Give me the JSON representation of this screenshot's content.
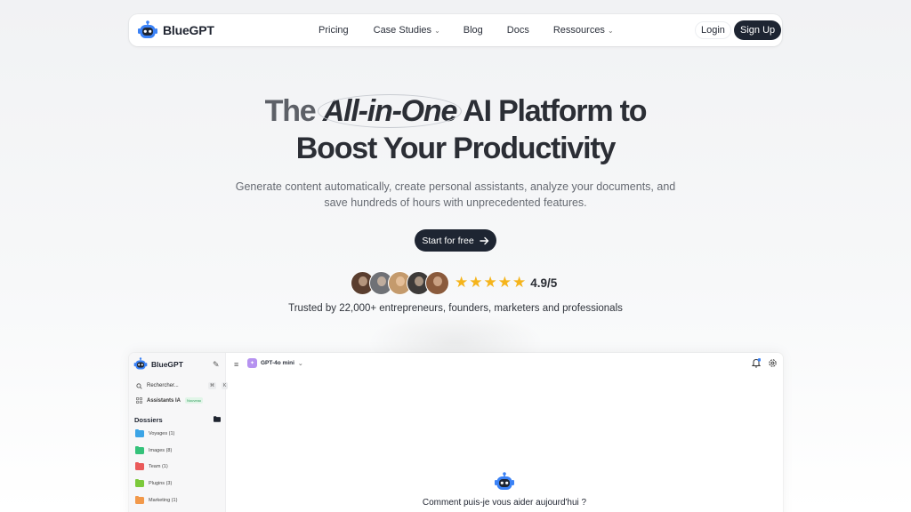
{
  "brand": {
    "name": "BlueGPT"
  },
  "nav": {
    "items": [
      {
        "label": "Pricing",
        "dropdown": false
      },
      {
        "label": "Case Studies",
        "dropdown": true
      },
      {
        "label": "Blog",
        "dropdown": false
      },
      {
        "label": "Docs",
        "dropdown": false
      },
      {
        "label": "Ressources",
        "dropdown": true
      }
    ],
    "login_label": "Login",
    "signup_label": "Sign Up"
  },
  "hero": {
    "title_part1": "The",
    "title_highlight": "All-in-One",
    "title_part2": "AI Platform to",
    "title_line2": "Boost Your Productivity",
    "subtitle": "Generate content automatically, create personal assistants, analyze your documents, and save hundreds of hours with unprecedented features.",
    "cta_label": "Start for free",
    "rating": "4.9/5",
    "stars": 5,
    "trusted": "Trusted by 22,000+ entrepreneurs, founders, marketers and professionals"
  },
  "app": {
    "brand_name": "BlueGPT",
    "search_placeholder": "Rechercher...",
    "search_shortcut": [
      "⌘",
      "K"
    ],
    "assistants_label": "Assistants IA",
    "assistants_badge": "Nouveau",
    "folders_heading": "Dossiers",
    "folders": [
      {
        "label": "Voyages (1)",
        "color": "#3ba4e6"
      },
      {
        "label": "Images (8)",
        "color": "#34c27a"
      },
      {
        "label": "Team (1)",
        "color": "#ea5a5a"
      },
      {
        "label": "Plugins (3)",
        "color": "#7cc93b"
      },
      {
        "label": "Marketing (1)",
        "color": "#f2994a"
      }
    ],
    "model_label": "GPT-4o mini",
    "prompt": "Comment puis-je vous aider aujourd'hui ?"
  },
  "colors": {
    "primary_dark": "#1e2532",
    "star": "#f5b41b",
    "brand_blue": "#3b82f6"
  }
}
